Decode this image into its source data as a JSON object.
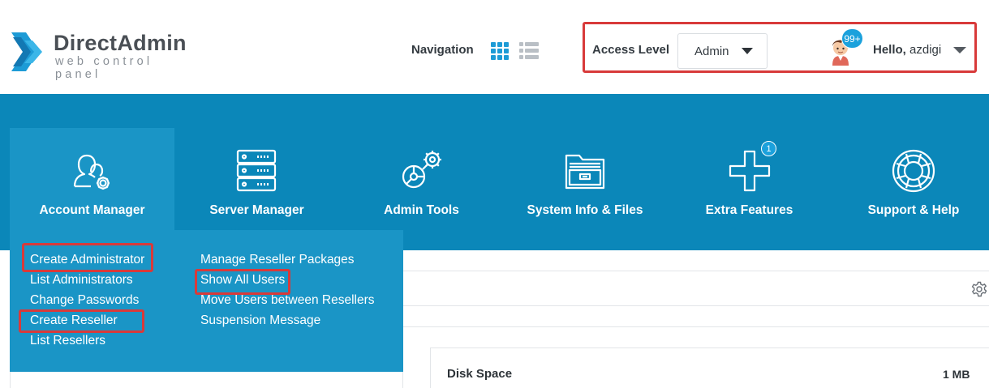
{
  "brand": {
    "title": "DirectAdmin",
    "subtitle": "web control panel",
    "accent": "#0b87b9"
  },
  "header": {
    "navigation_label": "Navigation",
    "grid_view_icon": "grid-view-icon",
    "list_view_icon": "list-view-icon",
    "access_level_label": "Access Level",
    "access_level_value": "Admin",
    "notifications_badge": "99+",
    "hello_prefix": "Hello,",
    "username": "azdigi"
  },
  "nav": {
    "items": [
      {
        "label": "Account Manager",
        "icon": "users-gear-icon",
        "active": true
      },
      {
        "label": "Server Manager",
        "icon": "server-icon"
      },
      {
        "label": "Admin Tools",
        "icon": "admin-tools-icon"
      },
      {
        "label": "System Info & Files",
        "icon": "folder-icon"
      },
      {
        "label": "Extra Features",
        "icon": "plus-icon",
        "badge": "1"
      },
      {
        "label": "Support & Help",
        "icon": "lifebuoy-icon"
      }
    ]
  },
  "account_menu": {
    "col1": [
      "Create Administrator",
      "List Administrators",
      "Change Passwords",
      "Create Reseller",
      "List Resellers"
    ],
    "col2": [
      "Manage Reseller Packages",
      "Show All Users",
      "Move Users between Resellers",
      "Suspension Message"
    ]
  },
  "highlight_color": "#d83a3a",
  "stats": {
    "disk_space_label": "Disk Space",
    "disk_space_value": "1 MB"
  }
}
